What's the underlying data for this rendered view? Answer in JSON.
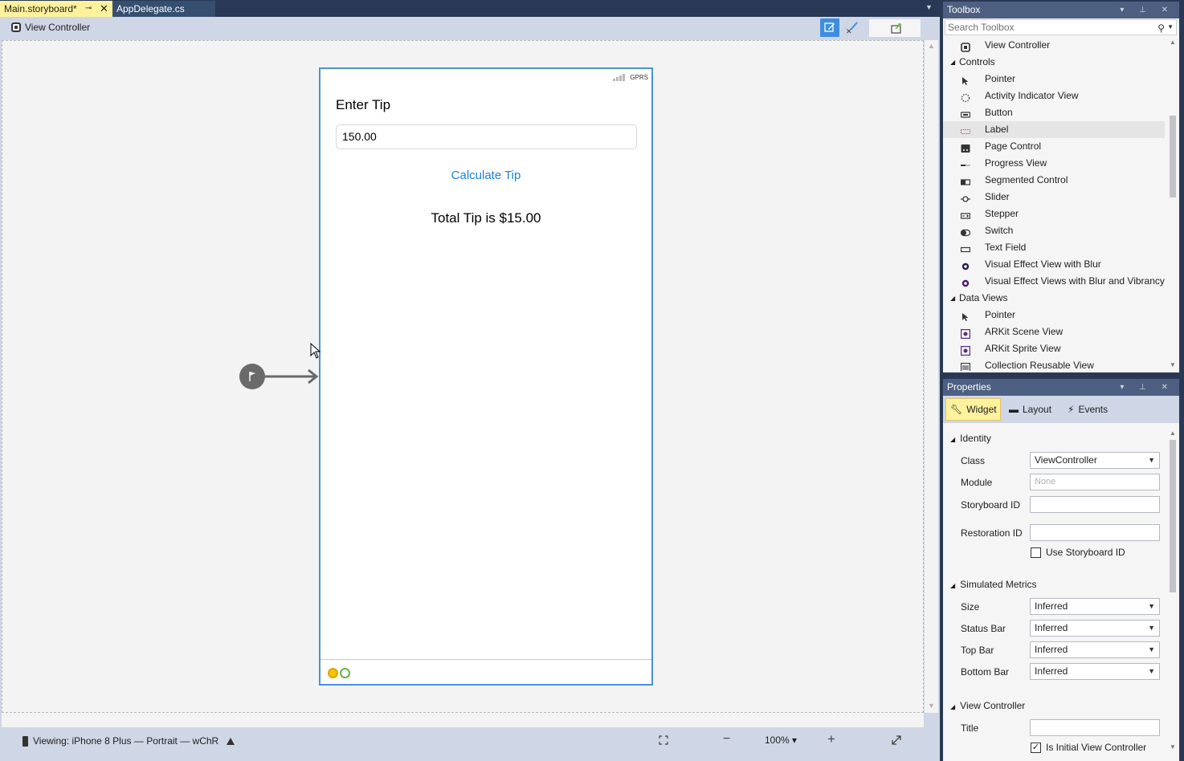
{
  "tabs": {
    "main": "Main.storyboard*",
    "appdelegate": "AppDelegate.cs"
  },
  "breadcrumb": {
    "label": "View Controller"
  },
  "device": {
    "status_network": "GPRS",
    "title_label": "Enter Tip",
    "tip_field_value": "150.00",
    "calc_button": "Calculate Tip",
    "total_label": "Total Tip is $15.00"
  },
  "bottom_bar": {
    "viewing": "Viewing: iPhone 8 Plus — Portrait — wChR",
    "zoom": "100%"
  },
  "toolbox": {
    "title": "Toolbox",
    "search_placeholder": "Search Toolbox",
    "rows": [
      {
        "kind": "item",
        "label": "View Controller",
        "icon": "view-controller-icon"
      },
      {
        "kind": "group",
        "label": "Controls"
      },
      {
        "kind": "item",
        "label": "Pointer",
        "icon": "pointer-icon"
      },
      {
        "kind": "item",
        "label": "Activity Indicator View",
        "icon": "activity-indicator-icon"
      },
      {
        "kind": "item",
        "label": "Button",
        "icon": "button-icon"
      },
      {
        "kind": "item",
        "label": "Label",
        "icon": "label-icon",
        "selected": true
      },
      {
        "kind": "item",
        "label": "Page Control",
        "icon": "page-control-icon"
      },
      {
        "kind": "item",
        "label": "Progress View",
        "icon": "progress-view-icon"
      },
      {
        "kind": "item",
        "label": "Segmented Control",
        "icon": "segmented-control-icon"
      },
      {
        "kind": "item",
        "label": "Slider",
        "icon": "slider-icon"
      },
      {
        "kind": "item",
        "label": "Stepper",
        "icon": "stepper-icon"
      },
      {
        "kind": "item",
        "label": "Switch",
        "icon": "switch-icon"
      },
      {
        "kind": "item",
        "label": "Text Field",
        "icon": "text-field-icon"
      },
      {
        "kind": "item",
        "label": "Visual Effect View with Blur",
        "icon": "visual-effect-icon"
      },
      {
        "kind": "item",
        "label": "Visual Effect Views with Blur and Vibrancy",
        "icon": "visual-effect-vibrancy-icon"
      },
      {
        "kind": "group",
        "label": "Data Views"
      },
      {
        "kind": "item",
        "label": "Pointer",
        "icon": "pointer-icon"
      },
      {
        "kind": "item",
        "label": "ARKit Scene View",
        "icon": "arkit-scene-icon"
      },
      {
        "kind": "item",
        "label": "ARKit Sprite View",
        "icon": "arkit-sprite-icon"
      },
      {
        "kind": "item",
        "label": "Collection Reusable View",
        "icon": "collection-reusable-icon"
      }
    ]
  },
  "properties": {
    "title": "Properties",
    "tabs": {
      "widget": "Widget",
      "layout": "Layout",
      "events": "Events"
    },
    "identity": {
      "header": "Identity",
      "class_label": "Class",
      "class_value": "ViewController",
      "module_label": "Module",
      "module_placeholder": "None",
      "storyboard_id_label": "Storyboard ID",
      "restoration_id_label": "Restoration ID",
      "use_storyboard_id": "Use Storyboard ID"
    },
    "simulated": {
      "header": "Simulated Metrics",
      "size_label": "Size",
      "size_value": "Inferred",
      "status_bar_label": "Status Bar",
      "status_bar_value": "Inferred",
      "top_bar_label": "Top Bar",
      "top_bar_value": "Inferred",
      "bottom_bar_label": "Bottom Bar",
      "bottom_bar_value": "Inferred"
    },
    "view_controller": {
      "header": "View Controller",
      "title_label": "Title",
      "is_initial": "Is Initial View Controller",
      "is_initial_checked": true
    }
  },
  "colors": {
    "active_tab": "#fff29d",
    "chrome_dark": "#293955",
    "chrome_light": "#cfd6e5",
    "device_border": "#4a90e2",
    "link_blue": "#1a82e2"
  }
}
